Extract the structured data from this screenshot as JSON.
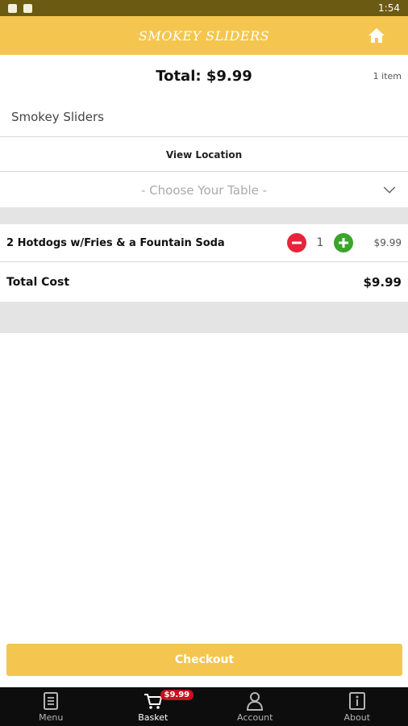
{
  "status_bar": {
    "time": "1:54"
  },
  "header": {
    "title": "SMOKEY SLIDERS"
  },
  "summary": {
    "total_label": "Total: $9.99",
    "item_count": "1 item"
  },
  "restaurant": {
    "name": "Smokey Sliders"
  },
  "location": {
    "link_label": "View Location"
  },
  "table_select": {
    "placeholder": "- Choose Your Table -"
  },
  "order_items": [
    {
      "name": "2 Hotdogs w/Fries & a Fountain Soda",
      "quantity": "1",
      "price": "$9.99"
    }
  ],
  "totals": {
    "label": "Total Cost",
    "value": "$9.99"
  },
  "checkout": {
    "label": "Checkout"
  },
  "nav": {
    "items": [
      {
        "label": "Menu",
        "icon": "menu-book-icon"
      },
      {
        "label": "Basket",
        "icon": "cart-icon",
        "badge": "$9.99",
        "active": true
      },
      {
        "label": "Account",
        "icon": "person-icon"
      },
      {
        "label": "About",
        "icon": "info-icon"
      }
    ]
  },
  "colors": {
    "accent": "#f4c64f",
    "status_bar": "#6b5a12",
    "minus": "#e8233a",
    "plus": "#3aa52a",
    "badge": "#c8101f",
    "nav_bg": "#0d0d0d"
  }
}
